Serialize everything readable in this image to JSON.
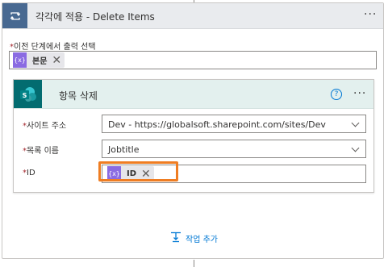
{
  "apply_each": {
    "title": "각각에 적용 - Delete Items",
    "more_label": "···",
    "output_field": {
      "required_mark": "*",
      "label": "이전 단계에서 출력 선택",
      "token": {
        "icon_text": "{x}",
        "label": "본문",
        "remove": "✕"
      }
    }
  },
  "delete_item": {
    "title": "항목 삭제",
    "help_label": "?",
    "more_label": "···",
    "site_address": {
      "required_mark": "*",
      "label": "사이트 주소",
      "value": "Dev - https://globalsoft.sharepoint.com/sites/Dev"
    },
    "list_name": {
      "required_mark": "*",
      "label": "목록 이름",
      "value": "Jobtitle"
    },
    "id_field": {
      "required_mark": "*",
      "label": "ID",
      "token": {
        "icon_text": "{x}",
        "label": "ID",
        "remove": "✕"
      }
    }
  },
  "add_action": {
    "label": "작업 추가"
  },
  "colors": {
    "loop_icon_bg": "#486991",
    "sharepoint_icon_bg": "#036c70",
    "token_icon_bg": "#8a6be2",
    "highlight": "#ef7d22",
    "link": "#0078d4"
  },
  "icons": [
    "loop-icon",
    "sharepoint-icon",
    "expression-icon",
    "close-icon",
    "help-icon",
    "chevron-down-icon",
    "add-action-icon"
  ]
}
